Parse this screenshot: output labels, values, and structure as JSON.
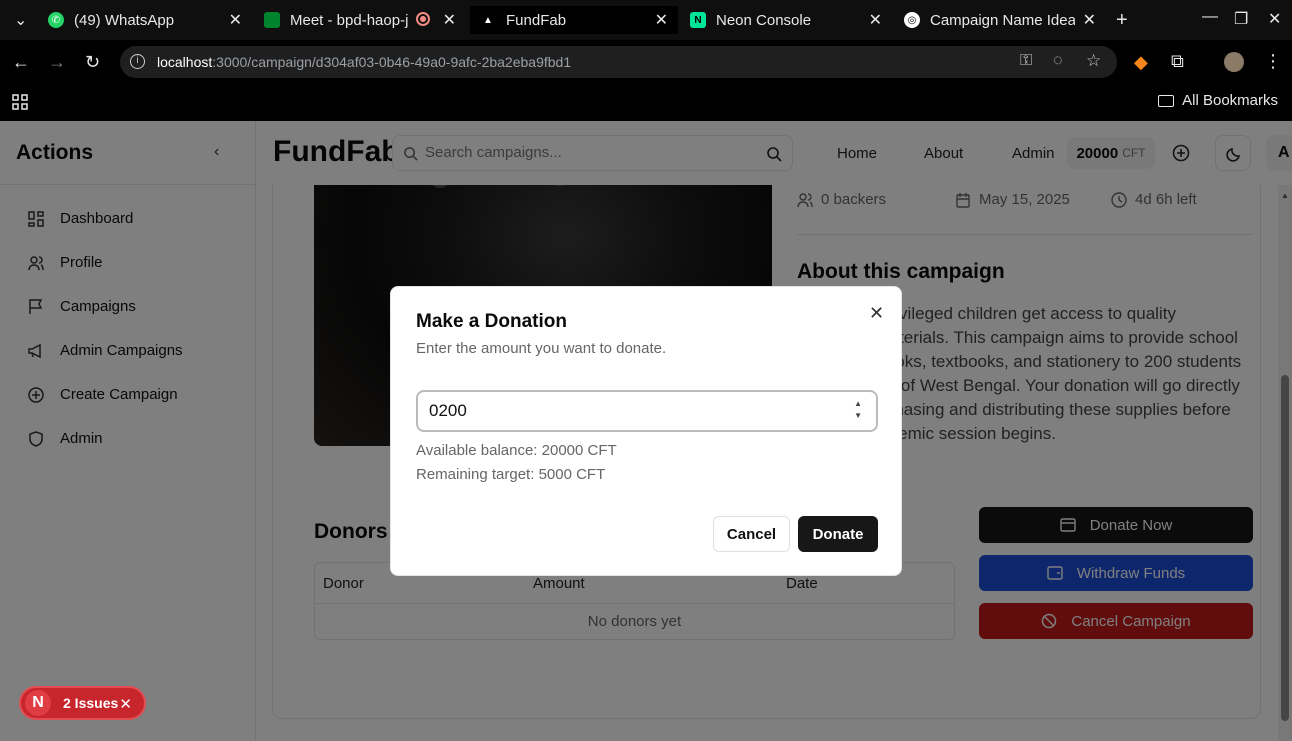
{
  "browser": {
    "tabs": [
      {
        "title": "(49) WhatsApp",
        "icon": "whatsapp-icon"
      },
      {
        "title": "Meet - bpd-haop-j",
        "icon": "meet-icon"
      },
      {
        "title": "FundFab",
        "icon": "fundfab-icon"
      },
      {
        "title": "Neon Console",
        "icon": "neon-icon"
      },
      {
        "title": "Campaign Name Idea",
        "icon": "chatgpt-icon"
      }
    ],
    "url_host": "localhost",
    "url_path": ":3000/campaign/d304af03-0b46-49a0-9afc-2ba2eba9fbd1",
    "bookmarks_label": "All Bookmarks"
  },
  "sidebar": {
    "title": "Actions",
    "items": [
      {
        "label": "Dashboard",
        "icon": "dashboard-icon"
      },
      {
        "label": "Profile",
        "icon": "users-icon"
      },
      {
        "label": "Campaigns",
        "icon": "flag-icon"
      },
      {
        "label": "Admin Campaigns",
        "icon": "megaphone-icon"
      },
      {
        "label": "Create Campaign",
        "icon": "plus-circle-icon"
      },
      {
        "label": "Admin",
        "icon": "shield-icon"
      }
    ]
  },
  "header": {
    "brand": "FundFab",
    "search_placeholder": "Search campaigns...",
    "nav": [
      "Home",
      "About",
      "Admin"
    ],
    "balance": "20000",
    "balance_unit": "CFT",
    "avatar_letter": "A"
  },
  "campaign": {
    "backers": "0 backers",
    "date": "May 15, 2025",
    "time_left": "4d 6h left",
    "about_title": "About this campaign",
    "about_text": "Help underprivileged children get access to quality education materials. This campaign aims to provide school bags, notebooks, textbooks, and stationery to 200 students in rural areas of West Bengal. Your donation will go directly towards purchasing and distributing these supplies before the new academic session begins.",
    "donors_title": "Donors",
    "columns": [
      "Donor",
      "Amount",
      "Date"
    ],
    "empty_text": "No donors yet",
    "donate_now": "Donate Now",
    "withdraw": "Withdraw Funds",
    "cancel_campaign": "Cancel Campaign"
  },
  "modal": {
    "title": "Make a Donation",
    "subtitle": "Enter the amount you want to donate.",
    "amount_value": "0200",
    "available": "Available balance: 20000 CFT",
    "remaining": "Remaining target: 5000 CFT",
    "cancel": "Cancel",
    "donate": "Donate"
  },
  "issues_badge": {
    "letter": "N",
    "label": "2 Issues"
  },
  "colors": {
    "primary": "#171717",
    "withdraw": "#1d4ed8",
    "danger": "#b91c1c",
    "issues": "#c8262d"
  }
}
